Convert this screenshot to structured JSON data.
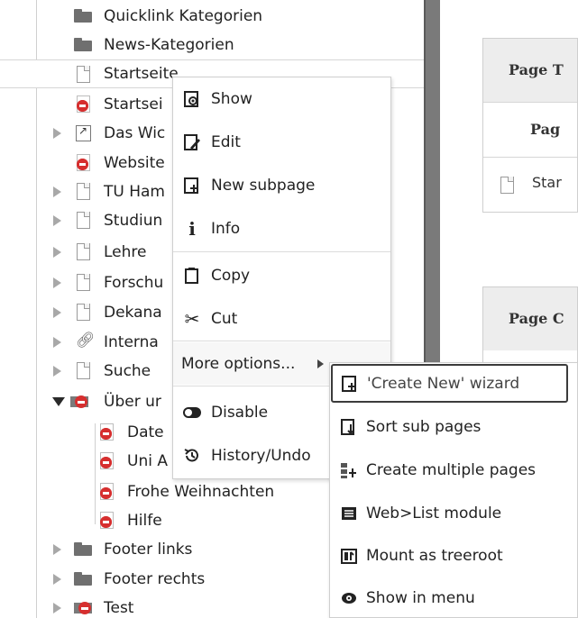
{
  "tree": {
    "items": [
      {
        "label": "Quicklink Kategorien",
        "icon": "folder-icon"
      },
      {
        "label": "News-Kategorien",
        "icon": "folder-icon"
      },
      {
        "label": "Startseite",
        "icon": "page-icon"
      },
      {
        "label": "Startsei",
        "icon": "page-hidden-icon"
      },
      {
        "label": "Das Wic",
        "icon": "shortcut-icon"
      },
      {
        "label": "Website",
        "icon": "page-hidden-icon"
      },
      {
        "label": "TU Ham",
        "icon": "page-icon"
      },
      {
        "label": "Studiun",
        "icon": "page-icon"
      },
      {
        "label": "Lehre",
        "icon": "page-icon"
      },
      {
        "label": "Forschu",
        "icon": "page-icon"
      },
      {
        "label": "Dekana",
        "icon": "page-icon"
      },
      {
        "label": "Interna",
        "icon": "link-icon"
      },
      {
        "label": "Suche",
        "icon": "page-icon"
      },
      {
        "label": "Über ur",
        "icon": "folder-hidden-icon"
      },
      {
        "label": "Date",
        "icon": "page-hidden-icon"
      },
      {
        "label": "Uni A",
        "icon": "page-hidden-icon"
      },
      {
        "label": "Frohe Weihnachten",
        "icon": "page-hidden-icon"
      },
      {
        "label": "Hilfe",
        "icon": "page-hidden-icon"
      },
      {
        "label": "Footer links",
        "icon": "folder-icon"
      },
      {
        "label": "Footer rechts",
        "icon": "folder-icon"
      },
      {
        "label": "Test",
        "icon": "folder-hidden-icon"
      }
    ]
  },
  "right_panel": {
    "box1_header": "Page T",
    "box1_col": "Pag",
    "box1_row": "Star",
    "box2_header": "Page C"
  },
  "context_menu": {
    "items": [
      {
        "label": "Show",
        "icon": "show-icon"
      },
      {
        "label": "Edit",
        "icon": "edit-icon"
      },
      {
        "label": "New subpage",
        "icon": "new-subpage-icon"
      },
      {
        "label": "Info",
        "icon": "info-icon"
      },
      {
        "label": "Copy",
        "icon": "copy-icon"
      },
      {
        "label": "Cut",
        "icon": "scissors-icon"
      },
      {
        "label": "More options...",
        "icon": "submenu-arrow-icon"
      },
      {
        "label": "Disable",
        "icon": "toggle-icon"
      },
      {
        "label": "History/Undo",
        "icon": "history-icon"
      }
    ]
  },
  "submenu": {
    "items": [
      {
        "label": "'Create New' wizard",
        "icon": "wizard-icon"
      },
      {
        "label": "Sort sub pages",
        "icon": "sort-icon"
      },
      {
        "label": "Create multiple pages",
        "icon": "multiple-pages-icon"
      },
      {
        "label": "Web>List module",
        "icon": "list-module-icon"
      },
      {
        "label": "Mount as treeroot",
        "icon": "mount-icon"
      },
      {
        "label": "Show in menu",
        "icon": "eye-icon"
      }
    ]
  }
}
